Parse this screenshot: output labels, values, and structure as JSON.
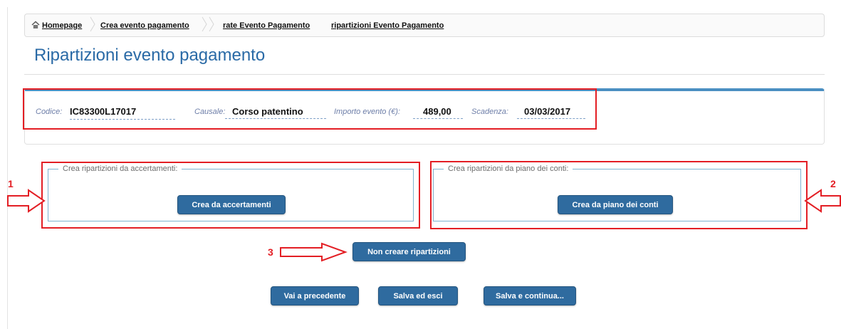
{
  "breadcrumb": {
    "home": "Homepage",
    "items": [
      "Crea evento pagamento",
      "rate Evento Pagamento",
      "ripartizioni Evento Pagamento"
    ]
  },
  "page_title": "Ripartizioni evento pagamento",
  "info": {
    "codice_label": "Codice:",
    "codice_value": "IC83300L17017",
    "causale_label": "Causale:",
    "causale_value": "Corso patentino",
    "importo_label": "Importo evento (€):",
    "importo_value": "489,00",
    "scadenza_label": "Scadenza:",
    "scadenza_value": "03/03/2017"
  },
  "groups": {
    "accertamenti": {
      "legend": "Crea ripartizioni da accertamenti:",
      "button": "Crea da accertamenti"
    },
    "piano_conti": {
      "legend": "Crea ripartizioni da piano dei conti:",
      "button": "Crea da piano dei conti"
    }
  },
  "non_creare_button": "Non creare ripartizioni",
  "footer_buttons": {
    "precedente": "Vai a precedente",
    "salva_esci": "Salva ed esci",
    "salva_continua": "Salva e continua..."
  },
  "annotations": {
    "one": "1",
    "two": "2",
    "three": "3"
  },
  "colors": {
    "accent": "#2f6b9f",
    "title": "#2a6aa6",
    "highlight": "#e31e24",
    "panel_top": "#4a8fc2"
  }
}
